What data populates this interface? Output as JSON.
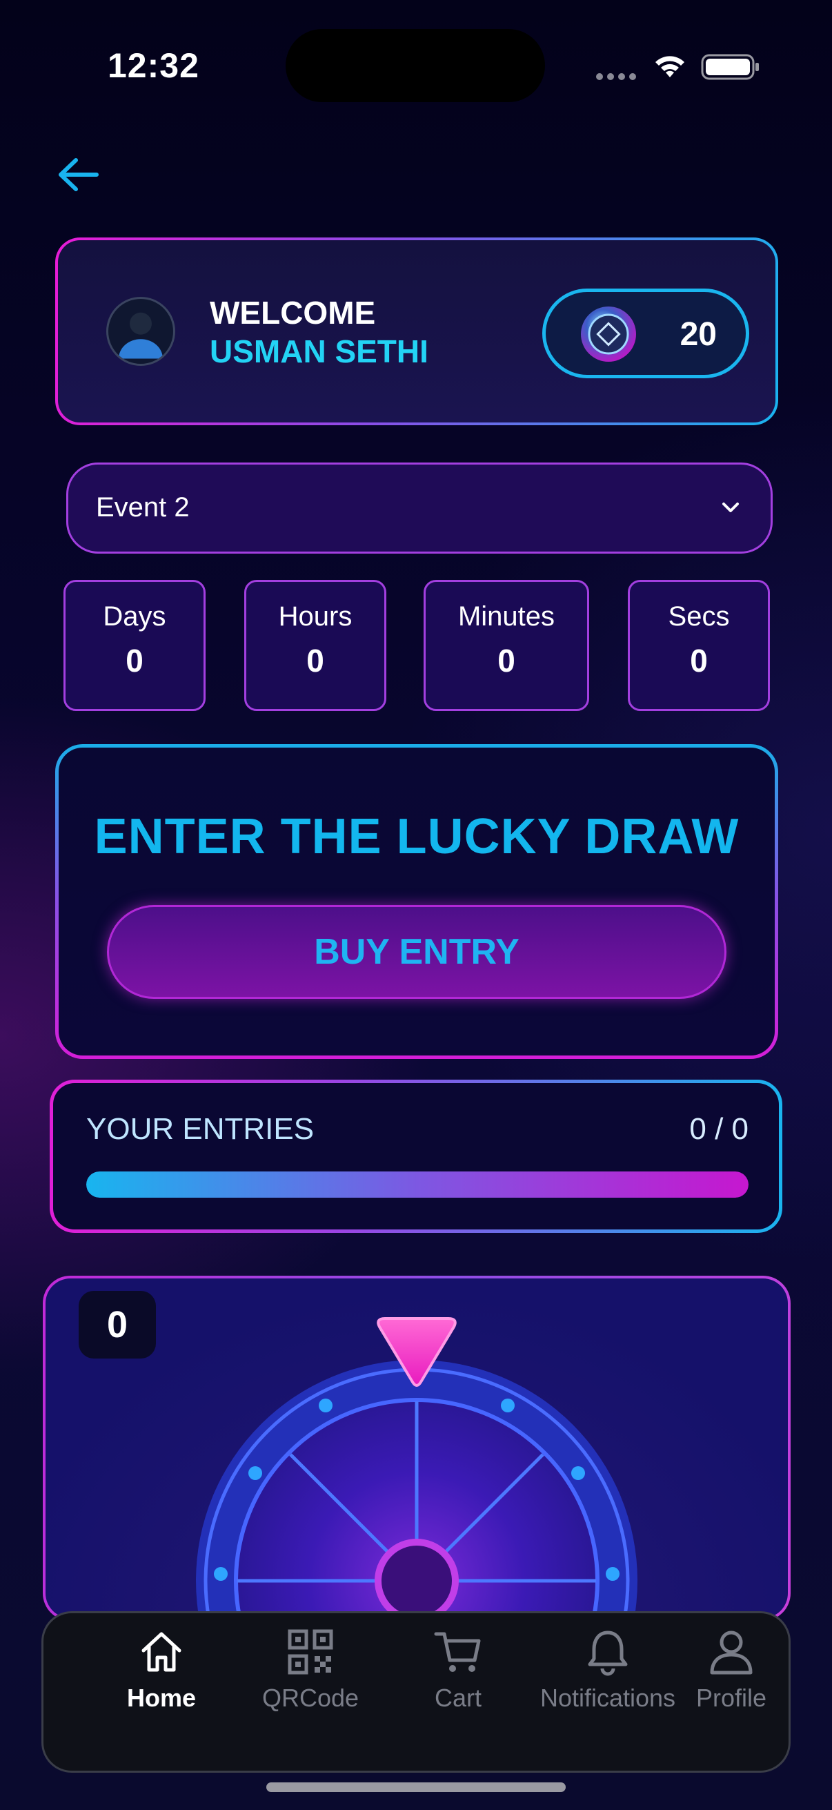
{
  "status_bar": {
    "time": "12:32"
  },
  "header": {
    "back_icon": "arrow-left-icon"
  },
  "welcome": {
    "greeting": "WELCOME",
    "user_name": "USMAN SETHI",
    "coins": "20"
  },
  "event_select": {
    "value": "Event 2"
  },
  "countdown": [
    {
      "label": "Days",
      "value": "0"
    },
    {
      "label": "Hours",
      "value": "0"
    },
    {
      "label": "Minutes",
      "value": "0"
    },
    {
      "label": "Secs",
      "value": "0"
    }
  ],
  "lucky_draw": {
    "title": "ENTER THE LUCKY DRAW",
    "button_label": "BUY ENTRY"
  },
  "entries": {
    "label": "YOUR ENTRIES",
    "count": "0 / 0",
    "progress": 1.0
  },
  "wheel": {
    "spin_count": "0"
  },
  "tab_bar": {
    "items": [
      {
        "label": "Home",
        "icon": "home-icon",
        "active": true
      },
      {
        "label": "QRCode",
        "icon": "qr-code-icon",
        "active": false
      },
      {
        "label": "Cart",
        "icon": "cart-icon",
        "active": false
      },
      {
        "label": "Notifications",
        "icon": "bell-icon",
        "active": false
      },
      {
        "label": "Profile",
        "icon": "profile-icon",
        "active": false
      }
    ]
  },
  "colors": {
    "accent_cyan": "#13b6ee",
    "accent_magenta": "#d51ed8",
    "purple_border": "#a33fe0",
    "background": "#07052b"
  }
}
